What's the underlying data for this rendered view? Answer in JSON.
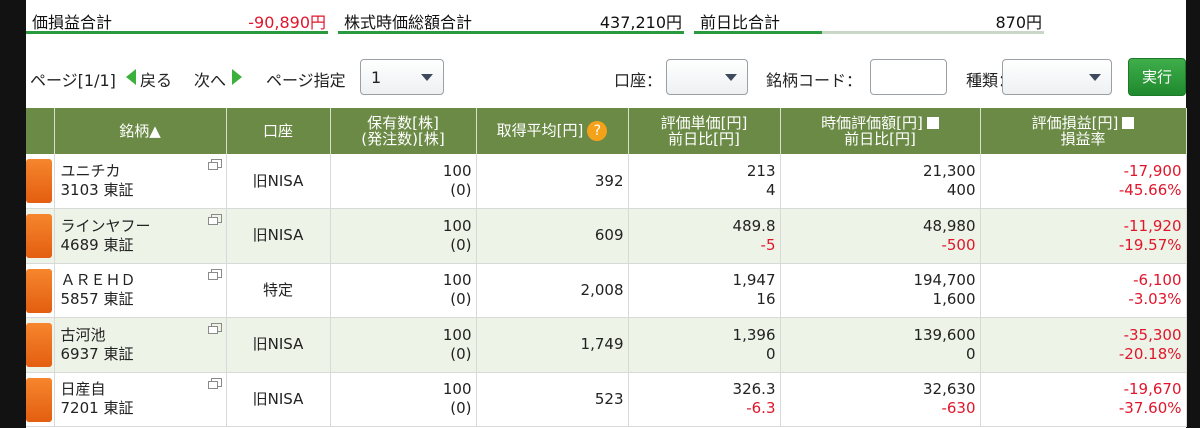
{
  "summary": {
    "pl_label": "価損益合計",
    "pl_value": "-90,890円",
    "market_label": "株式時価総額合計",
    "market_value": "437,210円",
    "change_label": "前日比合計",
    "change_value": "870円"
  },
  "pager": {
    "page_info": "ページ[1/1]",
    "back": "戻る",
    "next": "次へ",
    "page_select_label": "ページ指定",
    "page_select_value": "1",
    "account_label": "口座：",
    "account_value": "",
    "code_label": "銘柄コード：",
    "code_value": "",
    "type_label": "種類：",
    "type_value": "",
    "exec": "実行"
  },
  "table": {
    "headers": {
      "name": "銘柄▲",
      "account": "口座",
      "qty_line1": "保有数[株]",
      "qty_line2": "(発注数)[株]",
      "avg": "取得平均[円]",
      "avg_help": "?",
      "unit_line1": "評価単価[円]",
      "unit_line2": "前日比[円]",
      "mkt_line1": "時価評価額[円]",
      "mkt_line2": "前日比[円]",
      "pl_line1": "評価損益[円]",
      "pl_line2": "損益率"
    },
    "rows": [
      {
        "name": "ユニチカ",
        "code": "3103 東証",
        "account": "旧NISA",
        "qty": "100",
        "order_qty": "(0)",
        "avg": "392",
        "unit": "213",
        "unit_chg": "4",
        "mkt": "21,300",
        "mkt_chg": "400",
        "pl": "-17,900",
        "pl_rate": "-45.66%"
      },
      {
        "name": "ラインヤフー",
        "code": "4689 東証",
        "account": "旧NISA",
        "qty": "100",
        "order_qty": "(0)",
        "avg": "609",
        "unit": "489.8",
        "unit_chg": "-5",
        "mkt": "48,980",
        "mkt_chg": "-500",
        "pl": "-11,920",
        "pl_rate": "-19.57%"
      },
      {
        "name": "ＡＲＥＨＤ",
        "code": "5857 東証",
        "account": "特定",
        "qty": "100",
        "order_qty": "(0)",
        "avg": "2,008",
        "unit": "1,947",
        "unit_chg": "16",
        "mkt": "194,700",
        "mkt_chg": "1,600",
        "pl": "-6,100",
        "pl_rate": "-3.03%"
      },
      {
        "name": "古河池",
        "code": "6937 東証",
        "account": "旧NISA",
        "qty": "100",
        "order_qty": "(0)",
        "avg": "1,749",
        "unit": "1,396",
        "unit_chg": "0",
        "mkt": "139,600",
        "mkt_chg": "0",
        "pl": "-35,300",
        "pl_rate": "-20.18%"
      },
      {
        "name": "日産自",
        "code": "7201 東証",
        "account": "旧NISA",
        "qty": "100",
        "order_qty": "(0)",
        "avg": "523",
        "unit": "326.3",
        "unit_chg": "-6.3",
        "mkt": "32,630",
        "mkt_chg": "-630",
        "pl": "-19,670",
        "pl_rate": "-37.60%"
      }
    ]
  }
}
